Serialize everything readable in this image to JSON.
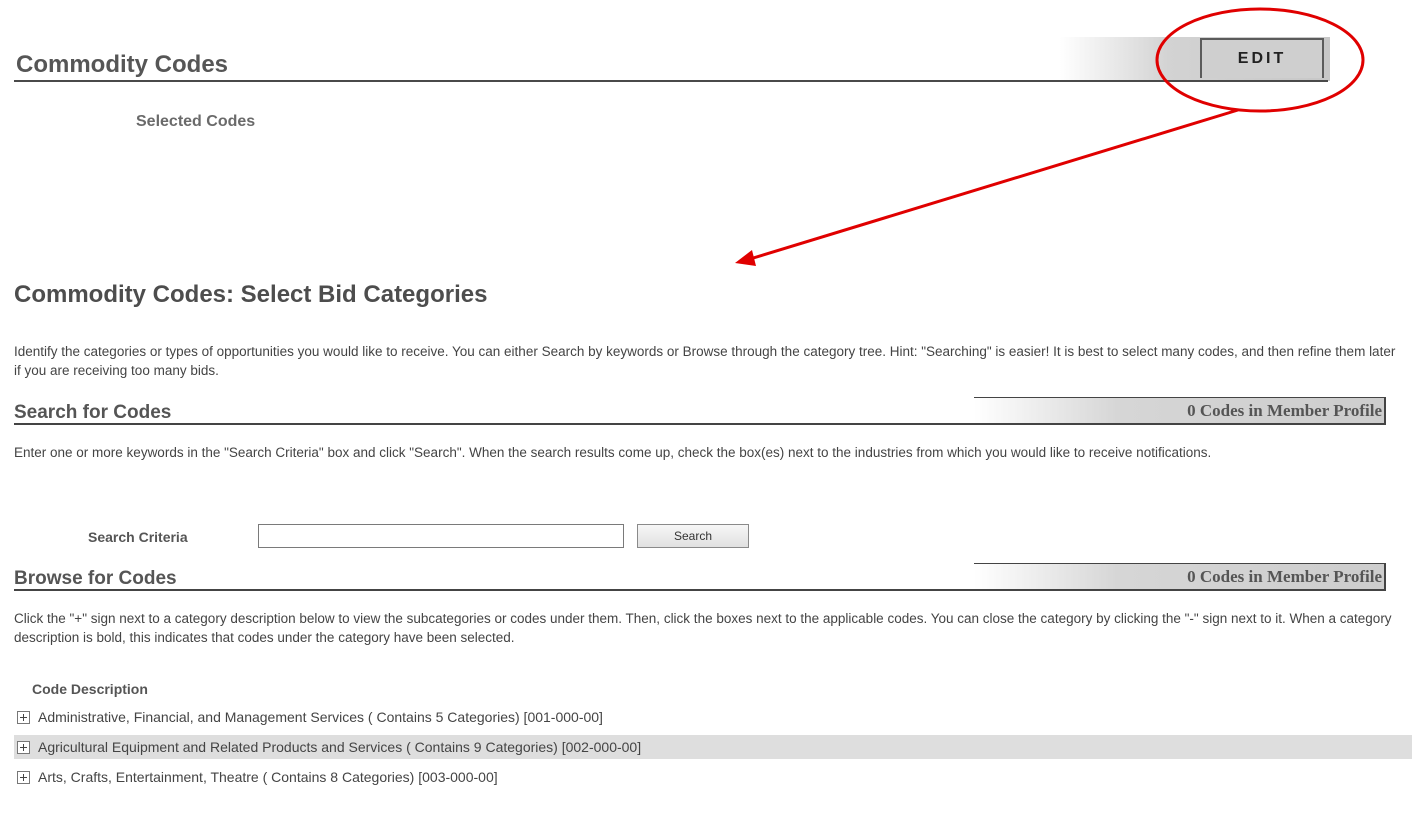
{
  "commodity": {
    "title": "Commodity Codes",
    "edit_label": "EDIT",
    "selected_codes_label": "Selected Codes"
  },
  "select": {
    "title": "Commodity Codes: Select Bid Categories",
    "intro": "Identify the categories or types of opportunities you would like to receive. You can either Search by keywords or Browse through the category tree. Hint: \"Searching\" is easier! It is best to select many codes, and then refine them later if you are receiving too many bids."
  },
  "search": {
    "heading": "Search for Codes",
    "count_label": "0 Codes in Member Profile",
    "description": "Enter one or more keywords in the \"Search Criteria\" box and click \"Search\". When the search results come up, check the box(es) next to the industries from which you would like to receive notifications.",
    "criteria_label": "Search Criteria",
    "input_value": "",
    "button_label": "Search"
  },
  "browse": {
    "heading": "Browse for Codes",
    "count_label": "0 Codes in Member Profile",
    "description": "Click the \"+\" sign next to a category description below to view the subcategories or codes under them. Then, click the boxes next to the applicable codes. You can close the category by clicking the \"-\" sign next to it. When a category description is bold, this indicates that codes under the category have been selected.",
    "column_header": "Code Description",
    "items": [
      {
        "label": "Administrative, Financial, and Management Services ( Contains 5 Categories) [001-000-00]"
      },
      {
        "label": "Agricultural Equipment and Related Products and Services ( Contains 9 Categories) [002-000-00]"
      },
      {
        "label": "Arts, Crafts, Entertainment, Theatre ( Contains 8 Categories) [003-000-00]"
      }
    ]
  },
  "annotation": {
    "color": "#e00000"
  }
}
